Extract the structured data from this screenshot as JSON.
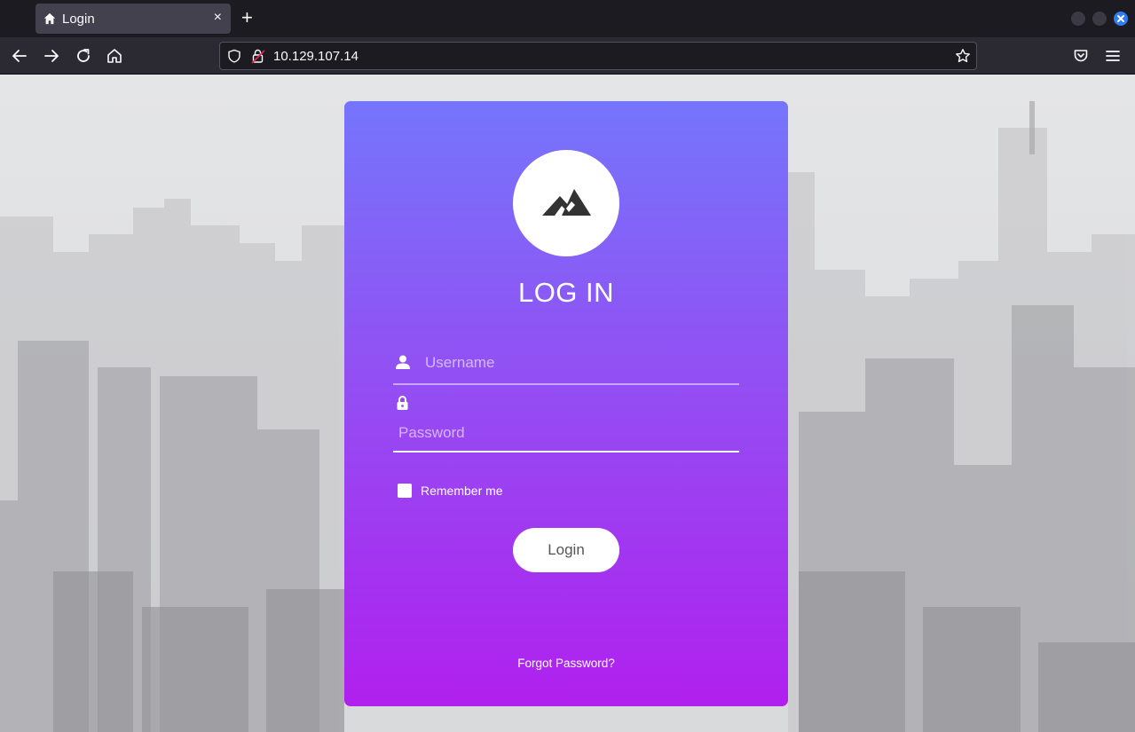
{
  "browser": {
    "tab_title": "Login",
    "url": "10.129.107.14",
    "close_glyph": "×",
    "newtab_glyph": "+",
    "icons": [
      "home-icon",
      "close-icon",
      "back-icon",
      "forward-icon",
      "reload-icon",
      "shield-icon",
      "lock-icon",
      "star-icon",
      "pocket-icon",
      "menu-icon"
    ]
  },
  "login": {
    "title": "LOG IN",
    "username_placeholder": "Username",
    "password_placeholder": "Password",
    "remember_label": "Remember me",
    "remember_checked": false,
    "button_label": "Login",
    "forgot_label": "Forgot Password?",
    "icons": [
      "mountain-logo-icon",
      "user-icon",
      "lock-icon"
    ]
  },
  "colors": {
    "card_top": "#7575fc",
    "card_bottom": "#b020ee",
    "chrome_bg": "#1c1b22",
    "toolbar_bg": "#2b2a33"
  }
}
